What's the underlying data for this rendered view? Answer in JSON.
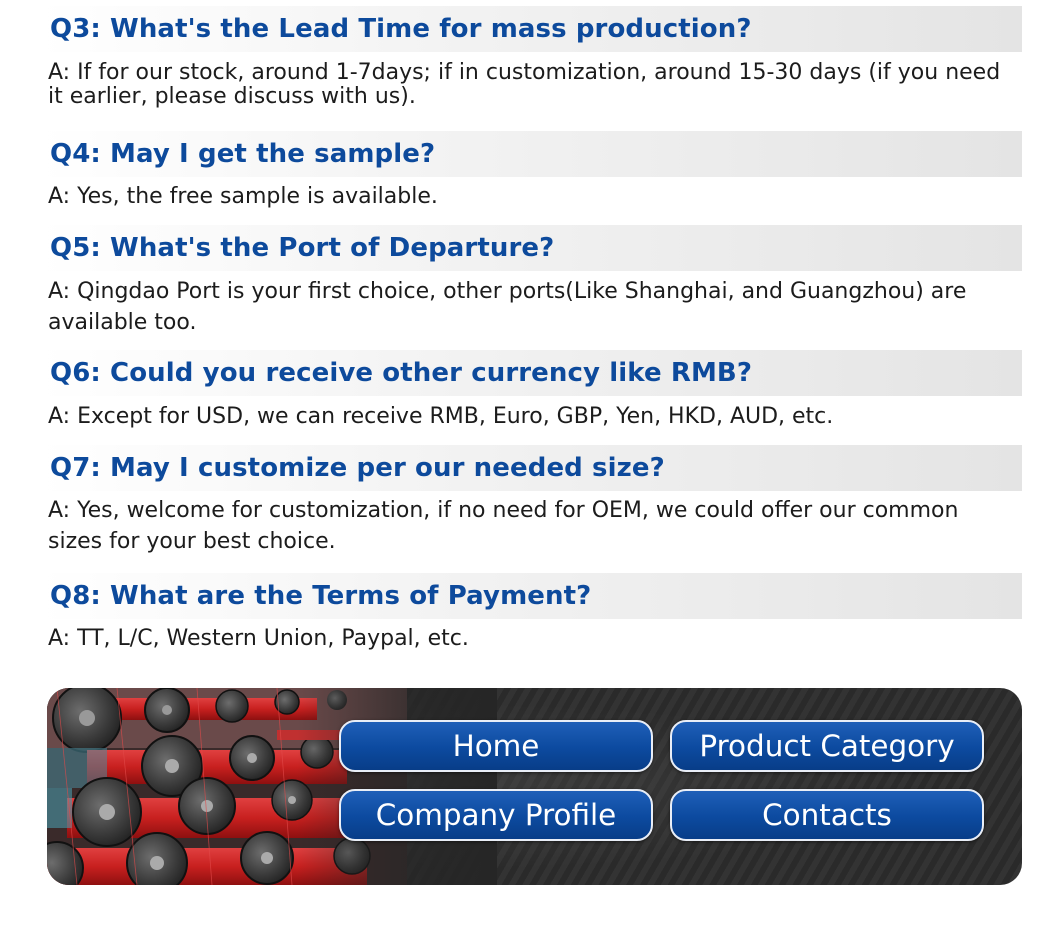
{
  "faq": [
    {
      "q": "Q3: What's the Lead Time for mass production?",
      "a": "A: If for our stock, around 1-7days; if in customization, around 15-30 days (if you need it earlier, please discuss with us)."
    },
    {
      "q": "Q4: May I get the sample?",
      "a": "A: Yes, the free sample is available."
    },
    {
      "q": "Q5: What's the Port of Departure?",
      "a": "A: Qingdao Port is your first choice, other ports(Like Shanghai, and Guangzhou) are available too."
    },
    {
      "q": "Q6: Could you receive other currency like RMB?",
      "a": "A: Except for USD, we can receive RMB, Euro, GBP, Yen, HKD, AUD, etc."
    },
    {
      "q": "Q7: May I customize per our needed size?",
      "a": "A: Yes, welcome for customization, if no need for OEM, we could offer our common sizes for your best choice."
    },
    {
      "q": "Q8: What are the Terms of Payment?",
      "a": "A: TT, L/C, Western Union, Paypal, etc."
    }
  ],
  "nav": {
    "home": "Home",
    "product_category": "Product Category",
    "company_profile": "Company Profile",
    "contacts": "Contacts"
  },
  "colors": {
    "question_blue": "#0d4a9c",
    "button_blue": "#0c4a9f",
    "thread_red": "#d42a2a"
  }
}
